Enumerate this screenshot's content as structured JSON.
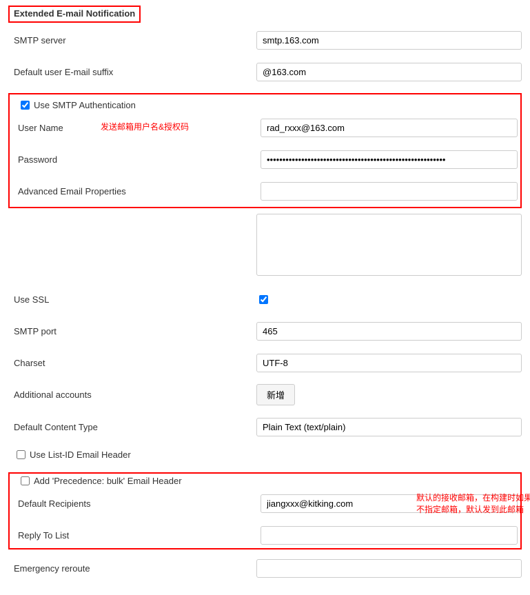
{
  "section_title": "Extended E-mail Notification",
  "smtp_server": {
    "label": "SMTP server",
    "value": "smtp.163.com"
  },
  "default_suffix": {
    "label": "Default user E-mail suffix",
    "value": "@163.com"
  },
  "use_smtp_auth": {
    "label": "Use SMTP Authentication",
    "checked": true
  },
  "red_note_1": "发送邮箱用户名&授权码",
  "user_name": {
    "label": "User Name",
    "value": "rad_rxxx@163.com"
  },
  "password": {
    "label": "Password",
    "value": "•••••••••••••••••••••••••••••••••••••••••••••••••••••••••"
  },
  "advanced_props": {
    "label": "Advanced Email Properties",
    "value": ""
  },
  "use_ssl": {
    "label": "Use SSL",
    "checked": true
  },
  "smtp_port": {
    "label": "SMTP port",
    "value": "465"
  },
  "charset": {
    "label": "Charset",
    "value": "UTF-8"
  },
  "additional_accounts": {
    "label": "Additional accounts",
    "button": "新增"
  },
  "default_content_type": {
    "label": "Default Content Type",
    "value": "Plain Text (text/plain)"
  },
  "use_list_id": {
    "label": "Use List-ID Email Header",
    "checked": false
  },
  "add_precedence": {
    "label": "Add 'Precedence: bulk' Email Header",
    "checked": false
  },
  "default_recipients": {
    "label": "Default Recipients",
    "value": "jiangxxx@kitking.com"
  },
  "red_note_2_line1": "默认的接收邮箱，在构建时如果",
  "red_note_2_line2": "不指定邮箱，默认发到此邮箱",
  "reply_to_list": {
    "label": "Reply To List",
    "value": ""
  },
  "emergency_reroute": {
    "label": "Emergency reroute",
    "value": ""
  }
}
